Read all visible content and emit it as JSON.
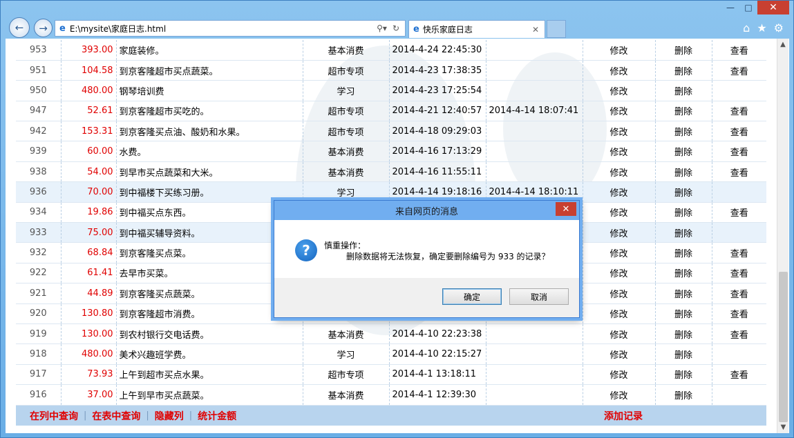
{
  "browser": {
    "url": "E:\\mysite\\家庭日志.html",
    "tab_title": "快乐家庭日志"
  },
  "rows": [
    {
      "id": "953",
      "amount": "393.00",
      "desc": "家庭装修。",
      "category": "基本消费",
      "time1": "2014-4-24 22:45:30",
      "time2": "",
      "edit": "修改",
      "del": "删除",
      "view": "查看"
    },
    {
      "id": "951",
      "amount": "104.58",
      "desc": "到京客隆超市买点蔬菜。",
      "category": "超市专项",
      "time1": "2014-4-23 17:38:35",
      "time2": "",
      "edit": "修改",
      "del": "删除",
      "view": "查看"
    },
    {
      "id": "950",
      "amount": "480.00",
      "desc": "钢琴培训费",
      "category": "学习",
      "time1": "2014-4-23 17:25:54",
      "time2": "",
      "edit": "修改",
      "del": "删除",
      "view": ""
    },
    {
      "id": "947",
      "amount": "52.61",
      "desc": "到京客隆超市买吃的。",
      "category": "超市专项",
      "time1": "2014-4-21 12:40:57",
      "time2": "2014-4-14 18:07:41",
      "edit": "修改",
      "del": "删除",
      "view": "查看"
    },
    {
      "id": "942",
      "amount": "153.31",
      "desc": "到京客隆买点油、酸奶和水果。",
      "category": "超市专项",
      "time1": "2014-4-18 09:29:03",
      "time2": "",
      "edit": "修改",
      "del": "删除",
      "view": "查看"
    },
    {
      "id": "939",
      "amount": "60.00",
      "desc": "水费。",
      "category": "基本消费",
      "time1": "2014-4-16 17:13:29",
      "time2": "",
      "edit": "修改",
      "del": "删除",
      "view": "查看"
    },
    {
      "id": "938",
      "amount": "54.00",
      "desc": "到早市买点蔬菜和大米。",
      "category": "基本消费",
      "time1": "2014-4-16 11:55:11",
      "time2": "",
      "edit": "修改",
      "del": "删除",
      "view": "查看"
    },
    {
      "id": "936",
      "amount": "70.00",
      "desc": "到中福楼下买练习册。",
      "category": "学习",
      "time1": "2014-4-14 19:18:16",
      "time2": "2014-4-14 18:10:11",
      "edit": "修改",
      "del": "删除",
      "view": ""
    },
    {
      "id": "934",
      "amount": "19.86",
      "desc": "到中福买点东西。",
      "category": "",
      "time1": "",
      "time2": "",
      "edit": "修改",
      "del": "删除",
      "view": "查看"
    },
    {
      "id": "933",
      "amount": "75.00",
      "desc": "到中福买辅导资料。",
      "category": "",
      "time1": "",
      "time2": "",
      "edit": "修改",
      "del": "删除",
      "view": ""
    },
    {
      "id": "932",
      "amount": "68.84",
      "desc": "到京客隆买点菜。",
      "category": "",
      "time1": "",
      "time2": "",
      "edit": "修改",
      "del": "删除",
      "view": "查看"
    },
    {
      "id": "922",
      "amount": "61.41",
      "desc": "去早市买菜。",
      "category": "",
      "time1": "",
      "time2": "",
      "edit": "修改",
      "del": "删除",
      "view": "查看"
    },
    {
      "id": "921",
      "amount": "44.89",
      "desc": "到京客隆买点蔬菜。",
      "category": "",
      "time1": "",
      "time2": "",
      "edit": "修改",
      "del": "删除",
      "view": "查看"
    },
    {
      "id": "920",
      "amount": "130.80",
      "desc": "到京客隆超市消费。",
      "category": "",
      "time1": "",
      "time2": "",
      "edit": "修改",
      "del": "删除",
      "view": "查看"
    },
    {
      "id": "919",
      "amount": "130.00",
      "desc": "到农村银行交电话费。",
      "category": "基本消费",
      "time1": "2014-4-10 22:23:38",
      "time2": "",
      "edit": "修改",
      "del": "删除",
      "view": "查看"
    },
    {
      "id": "918",
      "amount": "480.00",
      "desc": "美术兴趣班学费。",
      "category": "学习",
      "time1": "2014-4-10 22:15:27",
      "time2": "",
      "edit": "修改",
      "del": "删除",
      "view": ""
    },
    {
      "id": "917",
      "amount": "73.93",
      "desc": "上午到超市买点水果。",
      "category": "超市专项",
      "time1": "2014-4-1 13:18:11",
      "time2": "",
      "edit": "修改",
      "del": "删除",
      "view": "查看"
    },
    {
      "id": "916",
      "amount": "37.00",
      "desc": "上午到早市买点蔬菜。",
      "category": "基本消费",
      "time1": "2014-4-1 12:39:30",
      "time2": "",
      "edit": "修改",
      "del": "删除",
      "view": ""
    }
  ],
  "footer": {
    "search_column": "在列中查询",
    "search_table": "在表中查询",
    "hide_column": "隐藏列",
    "sum_amount": "统计金额",
    "add_record": "添加记录"
  },
  "dialog": {
    "title": "来自网页的消息",
    "message_line1": "慎重操作：",
    "message_line2": "删除数据将无法恢复，确定要删除编号为 933 的记录？",
    "ok": "确定",
    "cancel": "取消"
  }
}
